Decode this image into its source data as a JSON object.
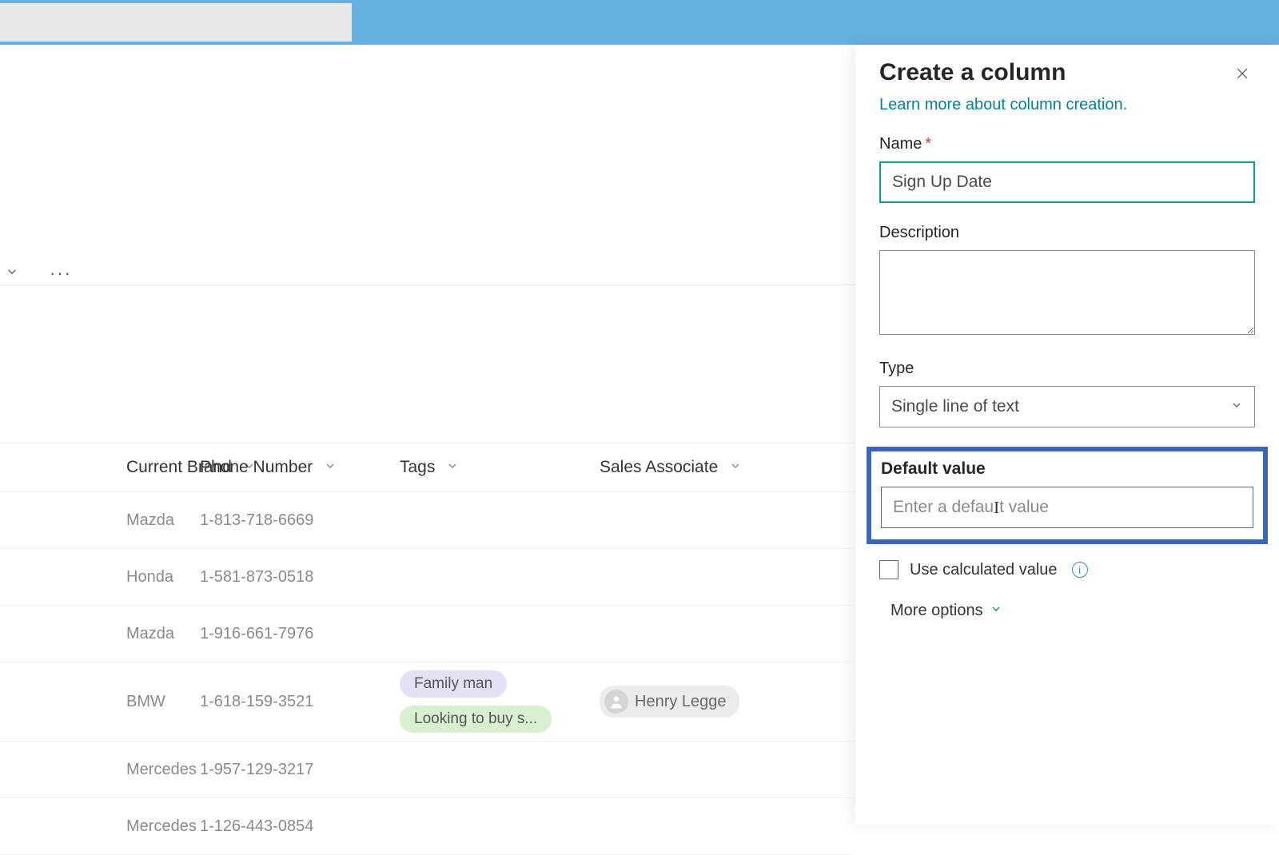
{
  "toolbar": {
    "dots": "···"
  },
  "table": {
    "headers": {
      "brand": "Current Brand",
      "phone": "Phone Number",
      "tags": "Tags",
      "assoc": "Sales Associate"
    },
    "rows": [
      {
        "brand": "Mazda",
        "phone": "1-813-718-6669",
        "tags": [],
        "assoc": ""
      },
      {
        "brand": "Honda",
        "phone": "1-581-873-0518",
        "tags": [],
        "assoc": ""
      },
      {
        "brand": "Mazda",
        "phone": "1-916-661-7976",
        "tags": [],
        "assoc": ""
      },
      {
        "brand": "BMW",
        "phone": "1-618-159-3521",
        "tags": [
          "Family man",
          "Looking to buy s..."
        ],
        "assoc": "Henry Legge"
      },
      {
        "brand": "Mercedes",
        "phone": "1-957-129-3217",
        "tags": [],
        "assoc": ""
      },
      {
        "brand": "Mercedes",
        "phone": "1-126-443-0854",
        "tags": [],
        "assoc": ""
      }
    ]
  },
  "panel": {
    "title": "Create a column",
    "learn_link": "Learn more about column creation.",
    "name_label": "Name",
    "name_value": "Sign Up Date",
    "description_label": "Description",
    "type_label": "Type",
    "type_value": "Single line of text",
    "default_label": "Default value",
    "default_placeholder_left": "Enter a defau",
    "default_placeholder_right": "t value",
    "calc_label": "Use calculated value",
    "more_options": "More options"
  },
  "tag_colors": [
    "tag-purple",
    "tag-green"
  ]
}
